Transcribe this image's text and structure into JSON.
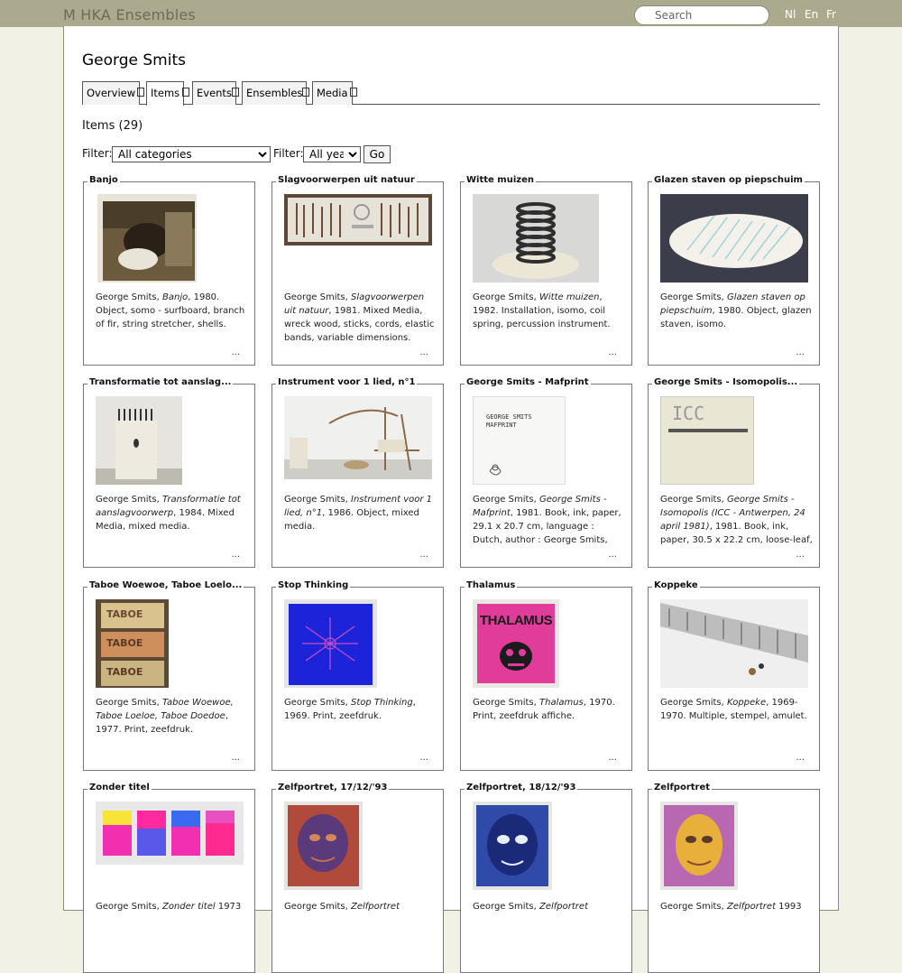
{
  "header": {
    "logo": "M HKA Ensembles",
    "search_placeholder": "Search",
    "languages": [
      "Nl",
      "En",
      "Fr"
    ]
  },
  "page": {
    "title": "George Smits",
    "tabs": [
      {
        "label": "Overview",
        "active": false
      },
      {
        "label": "Items",
        "active": true
      },
      {
        "label": "Events",
        "active": false
      },
      {
        "label": "Ensembles",
        "active": false
      },
      {
        "label": "Media",
        "active": false
      }
    ],
    "items_count": "Items (29)",
    "filter_label": "Filter:",
    "category_filter": "All categories",
    "year_filter": "All years",
    "go_label": "Go"
  },
  "items": [
    {
      "title": "Banjo",
      "author": "George Smits, ",
      "work": "Banjo",
      "details": ", 1980. Object, somo - surfboard, branch of fir, string stretcher, shells.",
      "more": "..."
    },
    {
      "title": "Slagvoorwerpen uit natuur",
      "author": "George Smits, ",
      "work": "Slagvoorwerpen uit natuur",
      "details": ", 1981. Mixed Media, wreck wood, sticks, cords, elastic bands, variable dimensions.",
      "more": "..."
    },
    {
      "title": "Witte muizen",
      "author": "George Smits, ",
      "work": "Witte muizen",
      "details": ", 1982. Installation, isomo, coil spring, percussion instrument.",
      "more": "..."
    },
    {
      "title": "Glazen staven op piepschuim",
      "author": "George Smits, ",
      "work": "Glazen staven op piepschuim",
      "details": ", 1980. Object, glazen staven, isomo.",
      "more": "..."
    },
    {
      "title": "Transformatie tot aanslag...",
      "author": "George Smits, ",
      "work": "Transformatie tot aanslagvoorwerp",
      "details": ", 1984. Mixed Media, mixed media.",
      "more": "..."
    },
    {
      "title": "Instrument voor 1 lied, n°1",
      "author": "George Smits, ",
      "work": "Instrument voor 1 lied, n°1",
      "details": ", 1986. Object, mixed media.",
      "more": "..."
    },
    {
      "title": "George Smits - Mafprint",
      "author": "George Smits, ",
      "work": "George Smits - Mafprint",
      "details": ", 1981. Book, ink, paper, 29.1 x 20.7 cm, language : Dutch, author : George Smits, publisher : de Warande, Turnhout.",
      "more": "..."
    },
    {
      "title": "George Smits - Isomopolis...",
      "author": "George Smits, ",
      "work": "George Smits - Isomopolis (ICC - Antwerpen, 24 april 1981)",
      "details": ", 1981. Book, ink, paper, 30.5 x 22.2 cm, loose-leaf, language : Dutch, publisher :",
      "more": "..."
    },
    {
      "title": "Taboe Woewoe, Taboe Loelo...",
      "author": "George Smits, ",
      "work": "Taboe Woewoe, Taboe Loeloe, Taboe Doedoe",
      "details": ", 1977. Print, zeefdruk.",
      "more": "..."
    },
    {
      "title": "Stop Thinking",
      "author": "George Smits, ",
      "work": "Stop Thinking",
      "details": ", 1969. Print, zeefdruk.",
      "more": "..."
    },
    {
      "title": "Thalamus",
      "author": "George Smits, ",
      "work": "Thalamus",
      "details": ", 1970. Print, zeefdruk affiche.",
      "more": "..."
    },
    {
      "title": "Koppeke",
      "author": "George Smits, ",
      "work": "Koppeke",
      "details": ", 1969-1970. Multiple, stempel, amulet.",
      "more": "..."
    },
    {
      "title": "Zonder titel",
      "author": "George Smits, ",
      "work": "Zonder titel",
      "details": " 1973",
      "more": ""
    },
    {
      "title": "Zelfportret, 17/12/'93",
      "author": "George Smits, ",
      "work": "Zelfportret",
      "details": "",
      "more": ""
    },
    {
      "title": "Zelfportret, 18/12/'93",
      "author": "George Smits, ",
      "work": "Zelfportret",
      "details": "",
      "more": ""
    },
    {
      "title": "Zelfportret",
      "author": "George Smits, ",
      "work": "Zelfportret",
      "details": " 1993",
      "more": ""
    }
  ],
  "thumb_text": {
    "mafprint": "GEORGE SMITS\nMAFPRINT",
    "icc": "ICC",
    "thalamus": "THALAMUS",
    "taboe": "TABOE"
  }
}
